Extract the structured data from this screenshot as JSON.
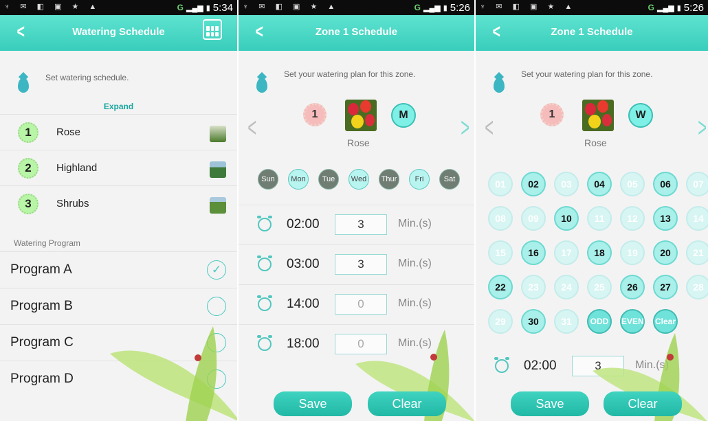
{
  "status": {
    "time_1": "5:34",
    "time_2": "5:26",
    "time_3": "5:26",
    "network": "G"
  },
  "screen1": {
    "title": "Watering Schedule",
    "hint": "Set watering schedule.",
    "expand_label": "Expand",
    "zones": [
      {
        "num": "1",
        "name": "Rose"
      },
      {
        "num": "2",
        "name": "Highland"
      },
      {
        "num": "3",
        "name": "Shrubs"
      }
    ],
    "program_header": "Watering Program",
    "programs": [
      {
        "name": "Program A",
        "checked": true
      },
      {
        "name": "Program B",
        "checked": false
      },
      {
        "name": "Program C",
        "checked": false
      },
      {
        "name": "Program D",
        "checked": false
      }
    ]
  },
  "screen2": {
    "title": "Zone 1  Schedule",
    "hint": "Set your watering plan for this zone.",
    "zone_num": "1",
    "zone_name": "Rose",
    "mode": "M",
    "days": [
      {
        "label": "Sun",
        "active": false
      },
      {
        "label": "Mon",
        "active": true
      },
      {
        "label": "Tue",
        "active": false
      },
      {
        "label": "Wed",
        "active": true
      },
      {
        "label": "Thur",
        "active": false
      },
      {
        "label": "Fri",
        "active": true
      },
      {
        "label": "Sat",
        "active": false
      }
    ],
    "times": [
      {
        "time": "02:00",
        "value": "3",
        "unit": "Min.(s)"
      },
      {
        "time": "03:00",
        "value": "3",
        "unit": "Min.(s)"
      },
      {
        "time": "14:00",
        "value": "0",
        "unit": "Min.(s)"
      },
      {
        "time": "18:00",
        "value": "0",
        "unit": "Min.(s)"
      }
    ],
    "save_label": "Save",
    "clear_label": "Clear"
  },
  "screen3": {
    "title": "Zone 1  Schedule",
    "hint": "Set your watering plan for this zone.",
    "zone_num": "1",
    "zone_name": "Rose",
    "mode": "W",
    "dates": [
      {
        "label": "01",
        "on": false
      },
      {
        "label": "02",
        "on": true
      },
      {
        "label": "03",
        "on": false
      },
      {
        "label": "04",
        "on": true
      },
      {
        "label": "05",
        "on": false
      },
      {
        "label": "06",
        "on": true
      },
      {
        "label": "07",
        "on": false
      },
      {
        "label": "08",
        "on": false
      },
      {
        "label": "09",
        "on": false
      },
      {
        "label": "10",
        "on": true
      },
      {
        "label": "11",
        "on": false
      },
      {
        "label": "12",
        "on": false
      },
      {
        "label": "13",
        "on": true
      },
      {
        "label": "14",
        "on": false
      },
      {
        "label": "15",
        "on": false
      },
      {
        "label": "16",
        "on": true
      },
      {
        "label": "17",
        "on": false
      },
      {
        "label": "18",
        "on": true
      },
      {
        "label": "19",
        "on": false
      },
      {
        "label": "20",
        "on": true
      },
      {
        "label": "21",
        "on": false
      },
      {
        "label": "22",
        "on": true
      },
      {
        "label": "23",
        "on": false
      },
      {
        "label": "24",
        "on": false
      },
      {
        "label": "25",
        "on": false
      },
      {
        "label": "26",
        "on": true
      },
      {
        "label": "27",
        "on": true
      },
      {
        "label": "28",
        "on": false
      },
      {
        "label": "29",
        "on": false
      },
      {
        "label": "30",
        "on": true
      },
      {
        "label": "31",
        "on": false
      }
    ],
    "odd_label": "ODD",
    "even_label": "EVEN",
    "clear_days_label": "Clear",
    "time": "02:00",
    "value": "3",
    "unit": "Min.(s)",
    "save_label": "Save",
    "clear_label": "Clear"
  }
}
